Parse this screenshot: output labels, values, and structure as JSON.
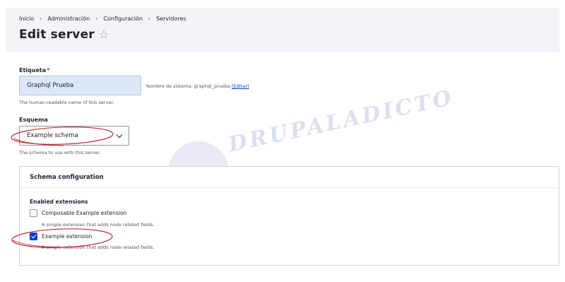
{
  "breadcrumb": [
    "Inicio",
    "Administración",
    "Configuración",
    "Servidores"
  ],
  "page_title": "Edit server",
  "label_field": {
    "label": "Etiqueta",
    "required_mark": "*",
    "value": "Graphql Prueba",
    "description": "The human-readable name of this server.",
    "machine_name_prefix": "Nombre de sistema: graphql_prueba ",
    "machine_name_link": "[Editar]"
  },
  "schema_field": {
    "label": "Esquema",
    "value": "Example schema",
    "description": "The schema to use with this server."
  },
  "schema_configuration": {
    "title": "Schema configuration",
    "extensions_label": "Enabled extensions",
    "extensions": [
      {
        "label": "Composable Example extension",
        "checked": false,
        "description": "A simple extension that adds node related fields."
      },
      {
        "label": "Example extension",
        "checked": true,
        "description": "A simple extension that adds node related fields."
      }
    ]
  },
  "watermark_text": "DRUPALADICTO",
  "colors": {
    "accent": "#003ecc",
    "annotation": "#c0161c",
    "header_bg": "#f3f4f9",
    "input_bg": "#dbe8f7"
  }
}
